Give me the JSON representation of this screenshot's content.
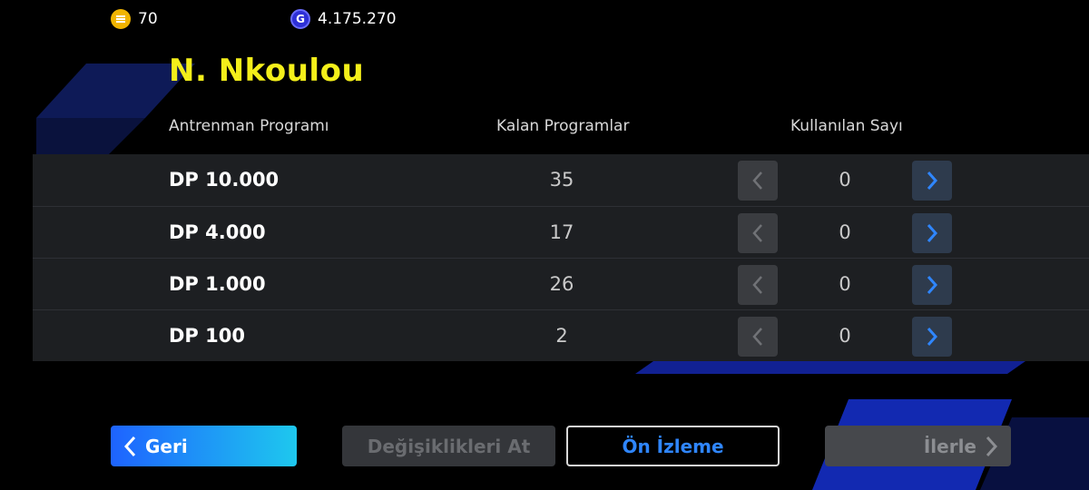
{
  "colors": {
    "accent_yellow": "#f4ef1a",
    "accent_blue": "#2f86ff",
    "table_bg": "#1d1f22",
    "coin": "#f0b400",
    "gp": "#2d2fd6"
  },
  "currency": {
    "coins": {
      "icon": "coin-icon",
      "value": "70"
    },
    "gp": {
      "icon": "gp-icon",
      "symbol": "G",
      "value": "4.175.270"
    }
  },
  "player": {
    "name": "N. Nkoulou"
  },
  "table": {
    "headers": {
      "program": "Antrenman Programı",
      "remaining": "Kalan Programlar",
      "used": "Kullanılan Sayı"
    },
    "rows": [
      {
        "name": "DP 10.000",
        "remaining": "35",
        "used": "0"
      },
      {
        "name": "DP 4.000",
        "remaining": "17",
        "used": "0"
      },
      {
        "name": "DP 1.000",
        "remaining": "26",
        "used": "0"
      },
      {
        "name": "DP 100",
        "remaining": "2",
        "used": "0"
      }
    ]
  },
  "buttons": {
    "back": "Geri",
    "discard": "Değişiklikleri At",
    "preview": "Ön İzleme",
    "next": "İlerle"
  }
}
